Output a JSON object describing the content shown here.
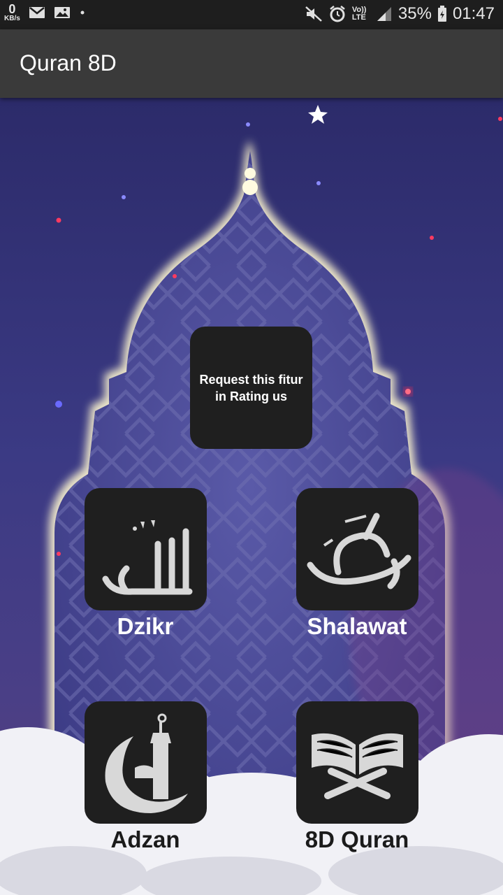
{
  "status_bar": {
    "speed_value": "0",
    "speed_unit": "KB/s",
    "network": "Vo)) LTE",
    "battery": "35%",
    "time": "01:47"
  },
  "app_bar": {
    "title": "Quran 8D"
  },
  "menu": {
    "request_tile": "Request this fitur in Rating us",
    "dzikr": "Dzikr",
    "shalawat": "Shalawat",
    "adzan": "Adzan",
    "quran": "8D Quran"
  },
  "colors": {
    "tile_bg": "#1f1f1f",
    "app_bar": "#3a3a3a",
    "status_bar": "#1e1e1e"
  }
}
